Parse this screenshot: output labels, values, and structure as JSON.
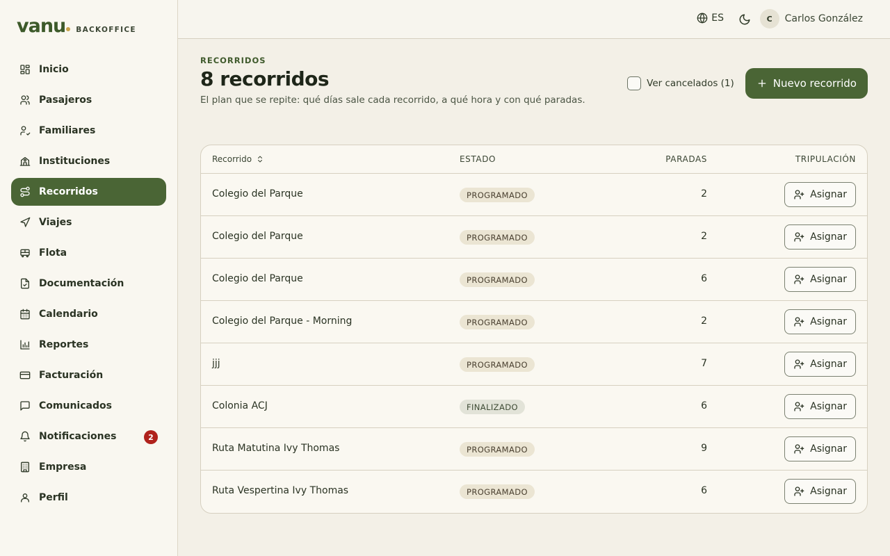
{
  "brand": {
    "name": "vanu",
    "subtitle": "BACKOFFICE"
  },
  "sidebar": {
    "items": [
      {
        "label": "Inicio",
        "icon": "dashboard-icon"
      },
      {
        "label": "Pasajeros",
        "icon": "users-icon"
      },
      {
        "label": "Familiares",
        "icon": "user-check-icon"
      },
      {
        "label": "Instituciones",
        "icon": "school-icon"
      },
      {
        "label": "Recorridos",
        "icon": "route-icon",
        "active": true
      },
      {
        "label": "Viajes",
        "icon": "navigation-icon"
      },
      {
        "label": "Flota",
        "icon": "bus-icon"
      },
      {
        "label": "Documentación",
        "icon": "file-check-icon"
      },
      {
        "label": "Calendario",
        "icon": "calendar-icon"
      },
      {
        "label": "Reportes",
        "icon": "bar-chart-icon"
      },
      {
        "label": "Facturación",
        "icon": "credit-card-icon"
      },
      {
        "label": "Comunicados",
        "icon": "message-icon"
      },
      {
        "label": "Notificaciones",
        "icon": "bell-icon",
        "badge": "2"
      },
      {
        "label": "Empresa",
        "icon": "building-icon"
      },
      {
        "label": "Perfil",
        "icon": "user-icon"
      }
    ]
  },
  "topbar": {
    "language": "ES",
    "user": {
      "initial": "C",
      "name": "Carlos González"
    }
  },
  "page": {
    "eyebrow": "RECORRIDOS",
    "title": "8 recorridos",
    "subtitle": "El plan que se repite: qué días sale cada recorrido, a qué hora y con qué paradas.",
    "show_cancelled_label": "Ver cancelados (1)",
    "new_button_label": "Nuevo recorrido"
  },
  "table": {
    "headers": {
      "route": "Recorrido",
      "status": "ESTADO",
      "stops": "PARADAS",
      "crew": "TRIPULACIÓN"
    },
    "assign_label": "Asignar",
    "rows": [
      {
        "name": "Colegio del Parque",
        "status": "PROGRAMADO",
        "status_kind": "prog",
        "stops": "2"
      },
      {
        "name": "Colegio del Parque",
        "status": "PROGRAMADO",
        "status_kind": "prog",
        "stops": "2"
      },
      {
        "name": "Colegio del Parque",
        "status": "PROGRAMADO",
        "status_kind": "prog",
        "stops": "6"
      },
      {
        "name": "Colegio del Parque - Morning",
        "status": "PROGRAMADO",
        "status_kind": "prog",
        "stops": "2"
      },
      {
        "name": "jjj",
        "status": "PROGRAMADO",
        "status_kind": "prog",
        "stops": "7"
      },
      {
        "name": "Colonia ACJ",
        "status": "FINALIZADO",
        "status_kind": "fin",
        "stops": "6"
      },
      {
        "name": "Ruta Matutina Ivy Thomas",
        "status": "PROGRAMADO",
        "status_kind": "prog",
        "stops": "9"
      },
      {
        "name": "Ruta Vespertina Ivy Thomas",
        "status": "PROGRAMADO",
        "status_kind": "prog",
        "stops": "6"
      }
    ]
  },
  "colors": {
    "accent": "#4a6535",
    "badge_alert": "#b0221c",
    "brand_dot": "#c8a24a"
  }
}
